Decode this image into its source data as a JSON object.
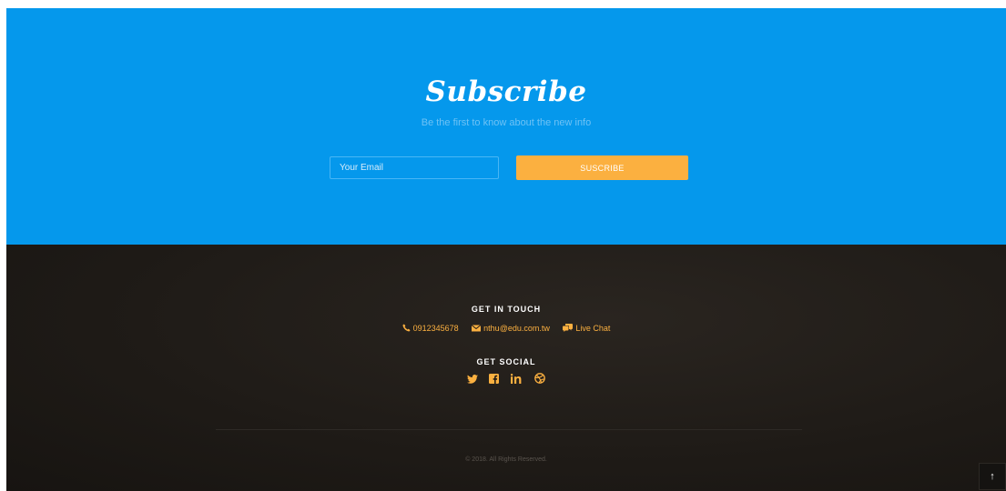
{
  "subscribe": {
    "title": "Subscribe",
    "subtitle": "Be the first to know about the new info",
    "email_placeholder": "Your Email",
    "button_label": "SUSCRIBE"
  },
  "footer": {
    "get_in_touch": {
      "heading": "GET IN TOUCH",
      "phone": "0912345678",
      "email": "nthu@edu.com.tw",
      "chat": "Live Chat"
    },
    "get_social": {
      "heading": "GET SOCIAL",
      "links": [
        {
          "name": "twitter-icon",
          "glyph": "🐦"
        },
        {
          "name": "facebook-icon",
          "glyph": "f"
        },
        {
          "name": "linkedin-icon",
          "glyph": "in"
        },
        {
          "name": "dribbble-icon",
          "glyph": "⊛"
        }
      ]
    },
    "copyright": "© 2018. All Rights Reserved."
  },
  "back_to_top": {
    "glyph": "↑"
  },
  "colors": {
    "subscribe_bg": "#0598ec",
    "accent": "#fbb040",
    "footer_bg": "#1f1b17"
  }
}
